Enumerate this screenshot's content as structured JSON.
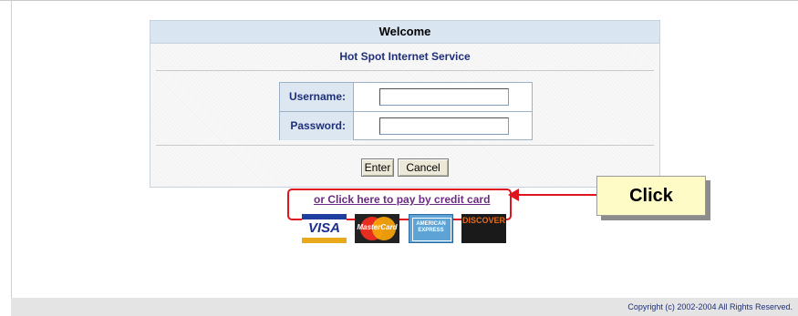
{
  "panel": {
    "title": "Welcome",
    "subtitle": "Hot Spot Internet Service"
  },
  "form": {
    "username_label": "Username:",
    "username_value": "",
    "password_label": "Password:",
    "password_value": "",
    "enter_label": "Enter",
    "cancel_label": "Cancel"
  },
  "payment": {
    "link_text": "or Click here to pay by credit card",
    "cards": [
      {
        "name": "visa",
        "label": "VISA"
      },
      {
        "name": "mastercard",
        "label": "MasterCard"
      },
      {
        "name": "amex",
        "label": "AMERICAN EXPRESS"
      },
      {
        "name": "discover",
        "label": "DISCOVER"
      }
    ]
  },
  "annotation": {
    "callout_text": "Click",
    "color": "#e0141e"
  },
  "footer": {
    "copyright": "Copyright (c) 2002-2004 All Rights Reserved."
  },
  "colors": {
    "header_bg": "#d9e5f1",
    "label_text": "#1d2f7a",
    "link_text": "#6b2b82",
    "callout_bg": "#fffbc6"
  }
}
